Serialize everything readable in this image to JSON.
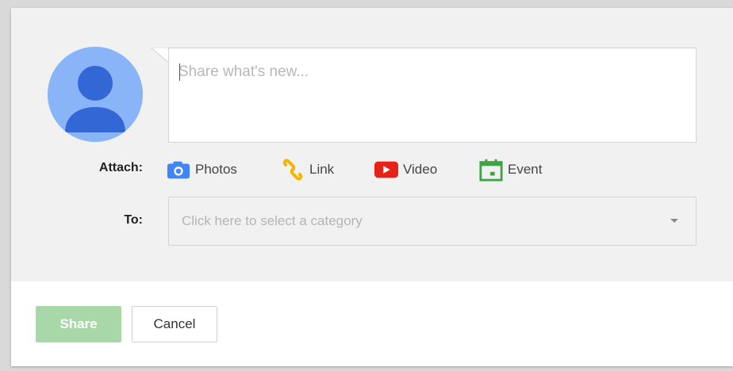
{
  "compose": {
    "placeholder": "Share what's new...",
    "attach_label": "Attach:",
    "to_label": "To:",
    "attachments": [
      {
        "label": "Photos",
        "icon": "camera-icon",
        "color": "#4285f4"
      },
      {
        "label": "Link",
        "icon": "link-icon",
        "color": "#f4b400"
      },
      {
        "label": "Video",
        "icon": "video-icon",
        "color": "#e62117"
      },
      {
        "label": "Event",
        "icon": "calendar-icon",
        "color": "#3ea343"
      }
    ],
    "category_select": {
      "placeholder": "Click here to select a category"
    }
  },
  "actions": {
    "share_label": "Share",
    "cancel_label": "Cancel"
  },
  "colors": {
    "avatar_bg": "#8ab4f8",
    "avatar_fg": "#3367d6",
    "share_button": "#a8d8a8"
  }
}
